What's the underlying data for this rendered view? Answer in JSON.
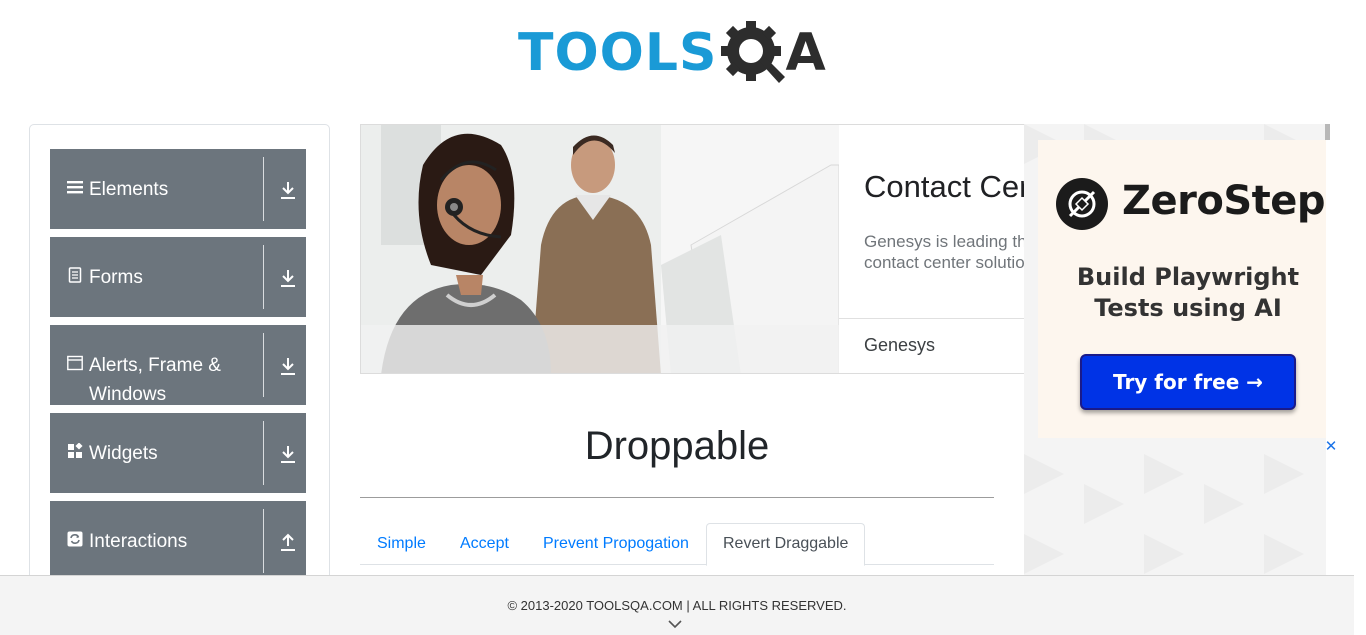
{
  "header": {
    "logo_text_primary": "TOOLS",
    "logo_text_secondary": "A",
    "logo_icon": "gear-q-icon",
    "brand_colors": {
      "tools": "#1a9ad6",
      "qa": "#2d2d2d"
    }
  },
  "sidebar": {
    "groups": [
      {
        "label": "Elements",
        "icon": "hamburger-icon",
        "arrow": "download-arrow-icon"
      },
      {
        "label": "Forms",
        "icon": "document-icon",
        "arrow": "download-arrow-icon"
      },
      {
        "label": "Alerts, Frame & Windows",
        "icon": "window-icon",
        "arrow": "download-arrow-icon"
      },
      {
        "label": "Widgets",
        "icon": "widgets-icon",
        "arrow": "download-arrow-icon"
      },
      {
        "label": "Interactions",
        "icon": "refresh-icon",
        "arrow": "upload-arrow-icon"
      }
    ],
    "group_color": "#6c757d"
  },
  "ad_top": {
    "title": "Contact Center Software",
    "description_line1": "Genesys is leading the",
    "description_line2": "contact center solutions",
    "brand": "Genesys"
  },
  "main": {
    "title": "Droppable",
    "tabs": [
      {
        "label": "Simple",
        "active": false
      },
      {
        "label": "Accept",
        "active": false
      },
      {
        "label": "Prevent Propogation",
        "active": false
      },
      {
        "label": "Revert Draggable",
        "active": true
      }
    ],
    "link_color": "#007bff"
  },
  "ad_right": {
    "brand": "ZeroStep",
    "tagline": "Build Playwright Tests using AI",
    "cta": "Try for free →",
    "close_label": "✕",
    "cta_color": "#0033e6"
  },
  "footer": {
    "copyright": "© 2013-2020 TOOLSQA.COM | ALL RIGHTS RESERVED."
  }
}
